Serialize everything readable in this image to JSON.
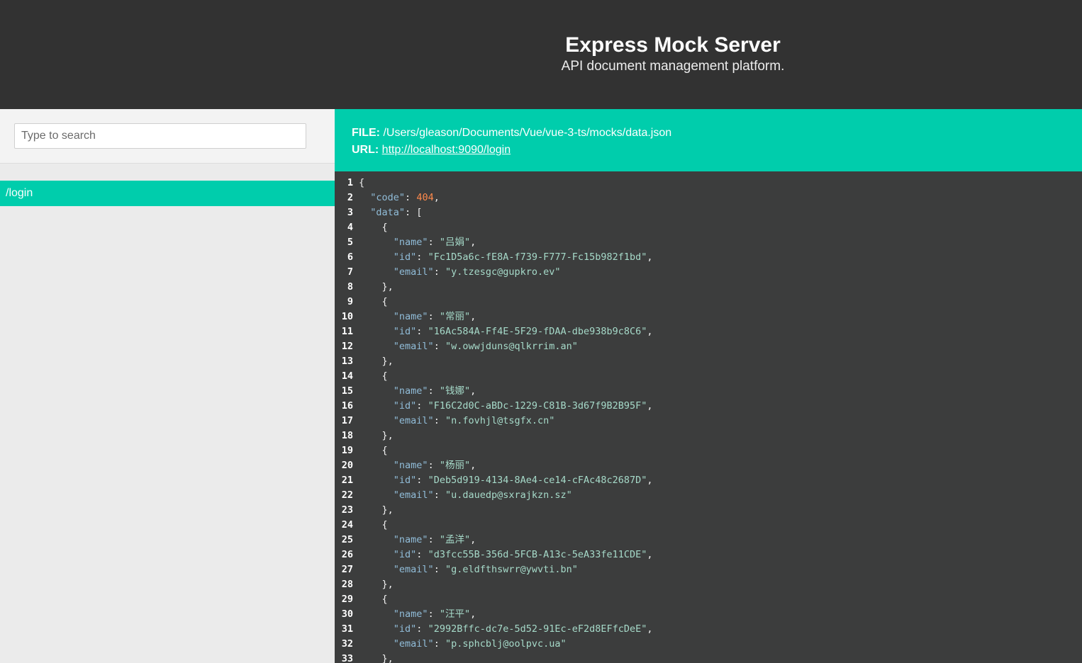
{
  "header": {
    "title": "Express Mock Server",
    "subtitle": "API document management platform."
  },
  "sidebar": {
    "search_placeholder": "Type to search",
    "routes": [
      "/login"
    ]
  },
  "info": {
    "file_label": "FILE:",
    "file_path": "/Users/gleason/Documents/Vue/vue-3-ts/mocks/data.json",
    "url_label": "URL:",
    "url": "http://localhost:9090/login"
  },
  "colors": {
    "header_bg": "#323232",
    "accent": "#00cdac",
    "sidebar_bg": "#ebebeb",
    "code_bg": "#3c3d3d",
    "json_key": "#91bdd9",
    "json_string": "#a6dac9",
    "json_number": "#ff8a4c"
  },
  "code_lines": [
    [
      [
        "p",
        "{"
      ]
    ],
    [
      [
        "p",
        "  "
      ],
      [
        "k",
        "\"code\""
      ],
      [
        "p",
        ": "
      ],
      [
        "n",
        "404"
      ],
      [
        "p",
        ","
      ]
    ],
    [
      [
        "p",
        "  "
      ],
      [
        "k",
        "\"data\""
      ],
      [
        "p",
        ": ["
      ]
    ],
    [
      [
        "p",
        "    {"
      ]
    ],
    [
      [
        "p",
        "      "
      ],
      [
        "k",
        "\"name\""
      ],
      [
        "p",
        ": "
      ],
      [
        "s",
        "\"吕娟\""
      ],
      [
        "p",
        ","
      ]
    ],
    [
      [
        "p",
        "      "
      ],
      [
        "k",
        "\"id\""
      ],
      [
        "p",
        ": "
      ],
      [
        "s",
        "\"Fc1D5a6c-fE8A-f739-F777-Fc15b982f1bd\""
      ],
      [
        "p",
        ","
      ]
    ],
    [
      [
        "p",
        "      "
      ],
      [
        "k",
        "\"email\""
      ],
      [
        "p",
        ": "
      ],
      [
        "s",
        "\"y.tzesgc@gupkro.ev\""
      ]
    ],
    [
      [
        "p",
        "    },"
      ]
    ],
    [
      [
        "p",
        "    {"
      ]
    ],
    [
      [
        "p",
        "      "
      ],
      [
        "k",
        "\"name\""
      ],
      [
        "p",
        ": "
      ],
      [
        "s",
        "\"常丽\""
      ],
      [
        "p",
        ","
      ]
    ],
    [
      [
        "p",
        "      "
      ],
      [
        "k",
        "\"id\""
      ],
      [
        "p",
        ": "
      ],
      [
        "s",
        "\"16Ac584A-Ff4E-5F29-fDAA-dbe938b9c8C6\""
      ],
      [
        "p",
        ","
      ]
    ],
    [
      [
        "p",
        "      "
      ],
      [
        "k",
        "\"email\""
      ],
      [
        "p",
        ": "
      ],
      [
        "s",
        "\"w.owwjduns@qlkrrim.an\""
      ]
    ],
    [
      [
        "p",
        "    },"
      ]
    ],
    [
      [
        "p",
        "    {"
      ]
    ],
    [
      [
        "p",
        "      "
      ],
      [
        "k",
        "\"name\""
      ],
      [
        "p",
        ": "
      ],
      [
        "s",
        "\"钱娜\""
      ],
      [
        "p",
        ","
      ]
    ],
    [
      [
        "p",
        "      "
      ],
      [
        "k",
        "\"id\""
      ],
      [
        "p",
        ": "
      ],
      [
        "s",
        "\"F16C2d0C-aBDc-1229-C81B-3d67f9B2B95F\""
      ],
      [
        "p",
        ","
      ]
    ],
    [
      [
        "p",
        "      "
      ],
      [
        "k",
        "\"email\""
      ],
      [
        "p",
        ": "
      ],
      [
        "s",
        "\"n.fovhjl@tsgfx.cn\""
      ]
    ],
    [
      [
        "p",
        "    },"
      ]
    ],
    [
      [
        "p",
        "    {"
      ]
    ],
    [
      [
        "p",
        "      "
      ],
      [
        "k",
        "\"name\""
      ],
      [
        "p",
        ": "
      ],
      [
        "s",
        "\"杨丽\""
      ],
      [
        "p",
        ","
      ]
    ],
    [
      [
        "p",
        "      "
      ],
      [
        "k",
        "\"id\""
      ],
      [
        "p",
        ": "
      ],
      [
        "s",
        "\"Deb5d919-4134-8Ae4-ce14-cFAc48c2687D\""
      ],
      [
        "p",
        ","
      ]
    ],
    [
      [
        "p",
        "      "
      ],
      [
        "k",
        "\"email\""
      ],
      [
        "p",
        ": "
      ],
      [
        "s",
        "\"u.dauedp@sxrajkzn.sz\""
      ]
    ],
    [
      [
        "p",
        "    },"
      ]
    ],
    [
      [
        "p",
        "    {"
      ]
    ],
    [
      [
        "p",
        "      "
      ],
      [
        "k",
        "\"name\""
      ],
      [
        "p",
        ": "
      ],
      [
        "s",
        "\"孟洋\""
      ],
      [
        "p",
        ","
      ]
    ],
    [
      [
        "p",
        "      "
      ],
      [
        "k",
        "\"id\""
      ],
      [
        "p",
        ": "
      ],
      [
        "s",
        "\"d3fcc55B-356d-5FCB-A13c-5eA33fe11CDE\""
      ],
      [
        "p",
        ","
      ]
    ],
    [
      [
        "p",
        "      "
      ],
      [
        "k",
        "\"email\""
      ],
      [
        "p",
        ": "
      ],
      [
        "s",
        "\"g.eldfthswrr@ywvti.bn\""
      ]
    ],
    [
      [
        "p",
        "    },"
      ]
    ],
    [
      [
        "p",
        "    {"
      ]
    ],
    [
      [
        "p",
        "      "
      ],
      [
        "k",
        "\"name\""
      ],
      [
        "p",
        ": "
      ],
      [
        "s",
        "\"汪平\""
      ],
      [
        "p",
        ","
      ]
    ],
    [
      [
        "p",
        "      "
      ],
      [
        "k",
        "\"id\""
      ],
      [
        "p",
        ": "
      ],
      [
        "s",
        "\"2992Bffc-dc7e-5d52-91Ec-eF2d8EFfcDeE\""
      ],
      [
        "p",
        ","
      ]
    ],
    [
      [
        "p",
        "      "
      ],
      [
        "k",
        "\"email\""
      ],
      [
        "p",
        ": "
      ],
      [
        "s",
        "\"p.sphcblj@oolpvc.ua\""
      ]
    ],
    [
      [
        "p",
        "    },"
      ]
    ]
  ]
}
